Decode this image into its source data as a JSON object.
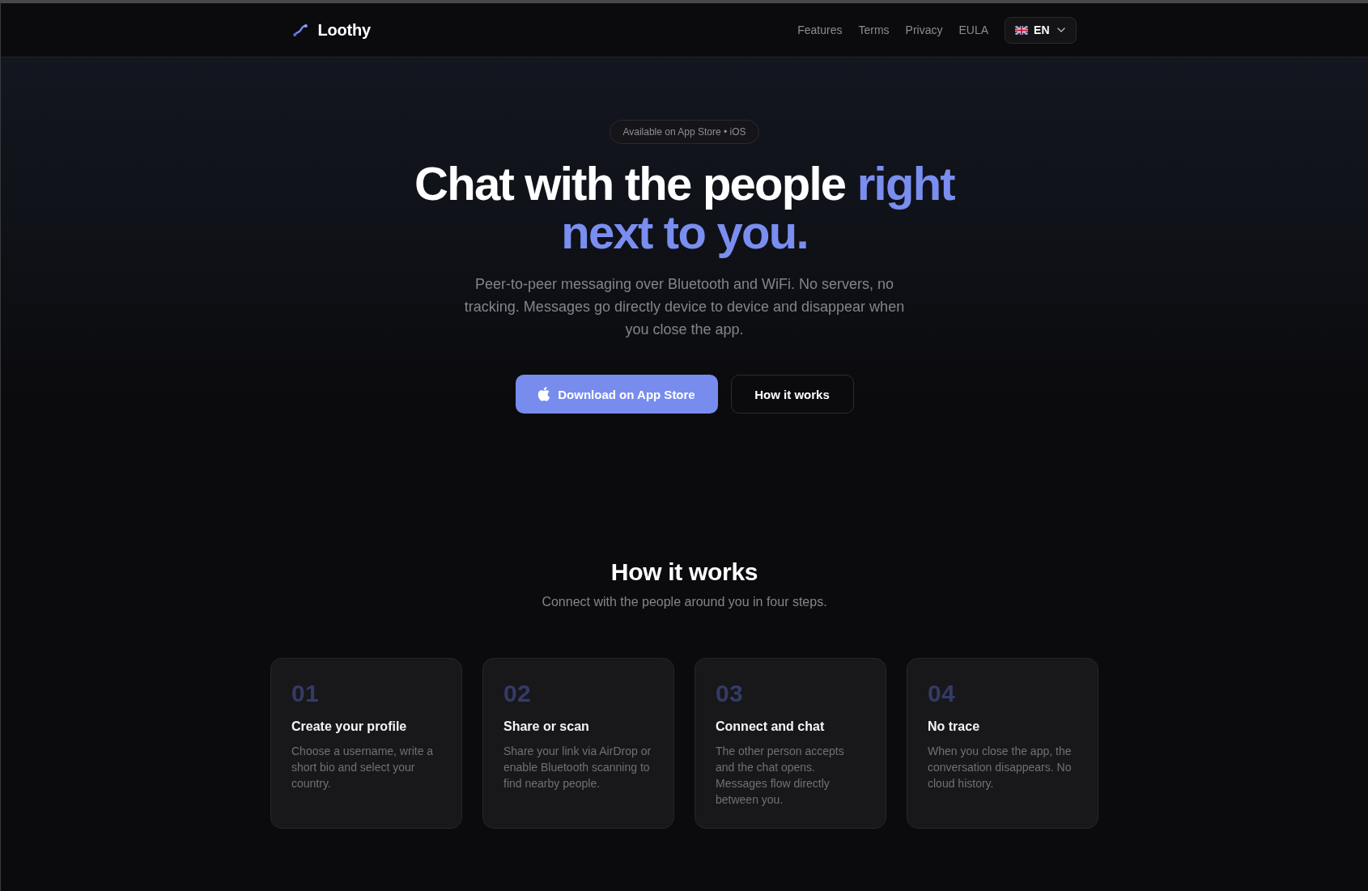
{
  "header": {
    "logo": "Loothy",
    "nav": [
      "Features",
      "Terms",
      "Privacy",
      "EULA"
    ],
    "language": {
      "code": "EN"
    }
  },
  "hero": {
    "badge": "Available on App Store • iOS",
    "title": "Chat with the people",
    "title_accent": "right next to you.",
    "text": "Peer-to-peer messaging over Bluetooth and WiFi. No servers, no tracking. Messages go directly device to device and disappear when you close the app.",
    "buttons": [
      {
        "kind": "primary",
        "label": "Download on App Store"
      },
      {
        "kind": "secondary",
        "label": "How it works"
      }
    ]
  },
  "how_it_works": {
    "title": "How it works",
    "subtitle": "Connect with the people around you in four steps.",
    "steps": [
      {
        "number": "01",
        "title": "Create your profile",
        "text": "Choose a username, write a short bio and select your country."
      },
      {
        "number": "02",
        "title": "Share or scan",
        "text": "Share your link via AirDrop or enable Bluetooth scanning to find nearby people."
      },
      {
        "number": "03",
        "title": "Connect and chat",
        "text": "The other person accepts and the chat opens. Messages flow directly between you."
      },
      {
        "number": "04",
        "title": "No trace",
        "text": "When you close the app, the conversation disappears. No cloud history."
      }
    ]
  }
}
